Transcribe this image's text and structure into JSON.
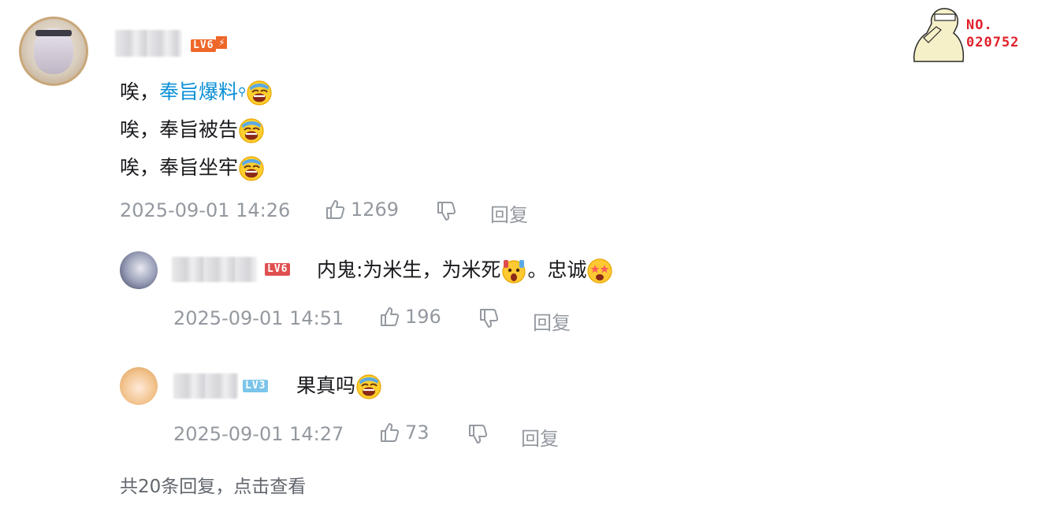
{
  "badge": {
    "line1": "NO.",
    "line2": "020752"
  },
  "root_comment": {
    "level": "LV6",
    "lines": [
      {
        "prefix": "唉，",
        "link": "奉旨爆料",
        "suffix": ""
      },
      {
        "prefix": "唉，奉旨被告",
        "link": "",
        "suffix": ""
      },
      {
        "prefix": "唉，奉旨坐牢",
        "link": "",
        "suffix": ""
      }
    ],
    "time": "2025-09-01 14:26",
    "likes": "1269",
    "reply_label": "回复"
  },
  "replies": [
    {
      "level": "LV6",
      "text_a": "内鬼:为米生，为米死",
      "text_b": "。忠诚",
      "time": "2025-09-01 14:51",
      "likes": "196",
      "reply_label": "回复"
    },
    {
      "level": "LV3",
      "text_a": "果真吗",
      "text_b": "",
      "time": "2025-09-01 14:27",
      "likes": "73",
      "reply_label": "回复"
    }
  ],
  "footer": {
    "text": "共20条回复，点击查看"
  },
  "icons": [
    "thumb-up-icon",
    "thumb-down-icon",
    "search-icon",
    "laugh-cry-emoji",
    "shocked-emoji",
    "star-eyes-emoji",
    "lightning-icon"
  ]
}
